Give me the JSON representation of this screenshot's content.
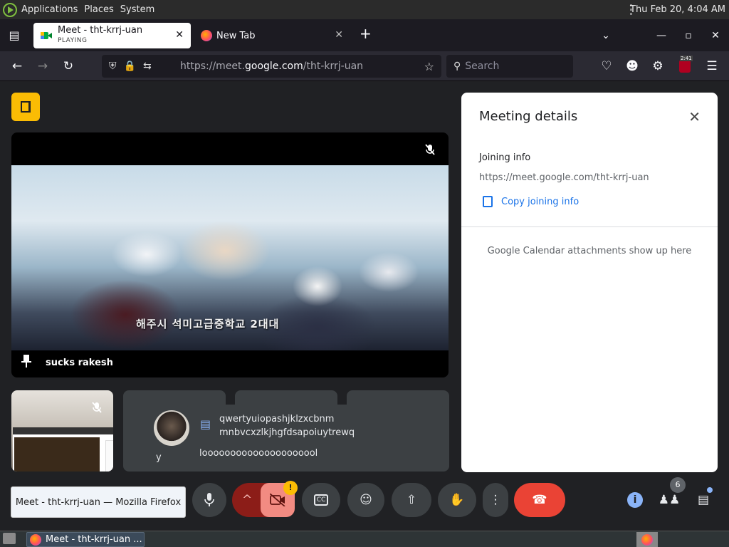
{
  "panel": {
    "menus": [
      "Applications",
      "Places",
      "System"
    ],
    "clock": "Thu Feb 20,  4:04 AM"
  },
  "tabs": [
    {
      "title": "Meet - tht-krrj-uan",
      "subtitle": "PLAYING",
      "active": true
    },
    {
      "title": "New Tab",
      "active": false
    }
  ],
  "nav": {
    "url_prefix": "https://meet.",
    "url_host": "google.com",
    "url_path": "/tht-krrj-uan",
    "search_placeholder": "Search",
    "ext_badge": "2:41"
  },
  "meet": {
    "main_participant": "sucks rakesh",
    "video_subtitle": "해주시 석미고급중학교 2대대",
    "chat_message_1": "qwertyuiopashjklzxcbnm",
    "chat_message_2": "mnbvcxzlkjhgfdsapoiuytrewq",
    "chat_message_3": "looooooooooooooooooool",
    "tile_label_fragment": "y",
    "details": {
      "title": "Meeting details",
      "joining_label": "Joining info",
      "joining_url": "https://meet.google.com/tht-krrj-uan",
      "copy_label": "Copy joining info",
      "calendar_note": "Google Calendar attachments show up here"
    },
    "people_count": "6",
    "alert_badge": "!",
    "tooltip": "Meet - tht-krrj-uan — Mozilla Firefox"
  },
  "taskbar": {
    "window_label": "Meet - tht-krrj-uan ..."
  },
  "colors": {
    "hangup": "#ea4335",
    "video_off": "#f28b82",
    "door": "#fbbc04",
    "link": "#1a73e8"
  }
}
